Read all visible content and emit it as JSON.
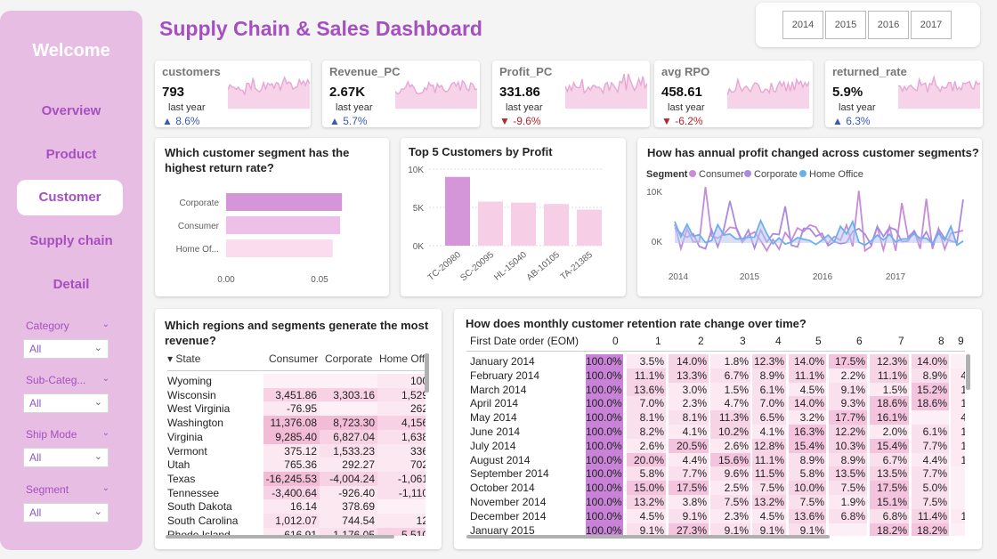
{
  "sidebar": {
    "welcome": "Welcome",
    "nav": [
      "Overview",
      "Product",
      "Customer",
      "Supply chain",
      "Detail"
    ],
    "active": "Customer",
    "filters": [
      {
        "label": "Category",
        "value": "All"
      },
      {
        "label": "Sub-Categ...",
        "value": "All"
      },
      {
        "label": "Ship Mode",
        "value": "All"
      },
      {
        "label": "Segment",
        "value": "All"
      }
    ]
  },
  "title": "Supply Chain & Sales Dashboard",
  "years": [
    "2014",
    "2015",
    "2016",
    "2017"
  ],
  "kpis": [
    {
      "label": "customers",
      "value": "793",
      "ly": "last year",
      "delta": "▲ 8.6%",
      "dir": "up"
    },
    {
      "label": "Revenue_PC",
      "value": "2.67K",
      "ly": "last year",
      "delta": "▲ 5.7%",
      "dir": "up"
    },
    {
      "label": "Profit_PC",
      "value": "331.86",
      "ly": "last year",
      "delta": "▼ -9.6%",
      "dir": "down"
    },
    {
      "label": "avg RPO",
      "value": "458.61",
      "ly": "last year",
      "delta": "▼ -6.2%",
      "dir": "down"
    },
    {
      "label": "returned_rate",
      "value": "5.9%",
      "ly": "last year",
      "delta": "▲ 6.3%",
      "dir": "up"
    }
  ],
  "colors": {
    "accent": "#a54fc1",
    "pink": "#e8bde3",
    "bar_dark": "#d596d9",
    "bar_light": "#f6cfe6",
    "consumer": "#c78bd8",
    "corporate": "#a98ae0",
    "home_office": "#6ab0ef"
  },
  "chart_data": [
    {
      "type": "bar",
      "orientation": "horizontal",
      "title": "Which customer segment has the highest return rate?",
      "categories": [
        "Corporate",
        "Consumer",
        "Home Of..."
      ],
      "values": [
        0.062,
        0.061,
        0.057
      ],
      "xticks": [
        "0.00",
        "0.05"
      ],
      "xlim": [
        0,
        0.07
      ]
    },
    {
      "type": "bar",
      "title": "Top 5 Customers by Profit",
      "categories": [
        "TC-20980",
        "SC-20095",
        "HL-15040",
        "AB-10105",
        "TA-21385"
      ],
      "values": [
        8981,
        5757,
        5622,
        5444,
        4703
      ],
      "yticks": [
        "10K",
        "5K",
        "0K"
      ],
      "ylim": [
        0,
        10000
      ]
    },
    {
      "type": "line",
      "title": "How has annual profit changed across customer segments?",
      "legend_title": "Segment",
      "series_names": [
        "Consumer",
        "Corporate",
        "Home Office"
      ],
      "yticks": [
        "10K",
        "0K"
      ],
      "xticks": [
        "2014",
        "2015",
        "2016",
        "2017"
      ]
    }
  ],
  "regions": {
    "title": "Which regions and segments generate the most revenue?",
    "headers": [
      "State",
      "Consumer",
      "Corporate",
      "Home Off"
    ],
    "rows": [
      [
        "Wyoming",
        "",
        "",
        "100"
      ],
      [
        "Wisconsin",
        "3,451.86",
        "3,303.16",
        "1,529"
      ],
      [
        "West Virginia",
        "-76.95",
        "",
        "262"
      ],
      [
        "Washington",
        "11,376.08",
        "8,723.30",
        "4,156"
      ],
      [
        "Virginia",
        "9,285.40",
        "6,827.04",
        "1,638"
      ],
      [
        "Vermont",
        "375.12",
        "1,533.23",
        "336"
      ],
      [
        "Utah",
        "765.36",
        "292.27",
        "702"
      ],
      [
        "Texas",
        "-16,245.53",
        "-4,004.24",
        "-1,061"
      ],
      [
        "Tennessee",
        "-3,400.64",
        "-926.40",
        "-1,110"
      ],
      [
        "South Dakota",
        "16.14",
        "378.69",
        ""
      ],
      [
        "South Carolina",
        "1,012.07",
        "744.54",
        "12"
      ],
      [
        "Rhode Island",
        "616.91",
        "1,176.05",
        "5,510"
      ]
    ]
  },
  "retention": {
    "title": "How does monthly customer retention rate change over time?",
    "row_header": "First Date order (EOM)",
    "cols": [
      "0",
      "1",
      "2",
      "3",
      "4",
      "5",
      "6",
      "7",
      "8",
      "9"
    ],
    "rows": [
      [
        "January 2014",
        "100.0%",
        "3.5%",
        "14.0%",
        "1.8%",
        "12.3%",
        "14.0%",
        "17.5%",
        "12.3%",
        "14.0%",
        ""
      ],
      [
        "February 2014",
        "100.0%",
        "11.1%",
        "13.3%",
        "6.7%",
        "8.9%",
        "11.1%",
        "2.2%",
        "11.1%",
        "8.9%",
        "4"
      ],
      [
        "March 2014",
        "100.0%",
        "13.6%",
        "3.0%",
        "1.5%",
        "6.1%",
        "4.5%",
        "9.1%",
        "1.5%",
        "15.2%",
        "1"
      ],
      [
        "April 2014",
        "100.0%",
        "7.0%",
        "2.3%",
        "4.7%",
        "7.0%",
        "14.0%",
        "9.3%",
        "18.6%",
        "18.6%",
        "1"
      ],
      [
        "May 2014",
        "100.0%",
        "8.1%",
        "8.1%",
        "11.3%",
        "6.5%",
        "3.2%",
        "17.7%",
        "16.1%",
        "",
        "4"
      ],
      [
        "June 2014",
        "100.0%",
        "8.2%",
        "4.1%",
        "10.2%",
        "4.1%",
        "16.3%",
        "12.2%",
        "2.0%",
        "6.1%",
        "1"
      ],
      [
        "July 2014",
        "100.0%",
        "2.6%",
        "20.5%",
        "2.6%",
        "12.8%",
        "15.4%",
        "10.3%",
        "15.4%",
        "7.7%",
        "1"
      ],
      [
        "August 2014",
        "100.0%",
        "20.0%",
        "4.4%",
        "15.6%",
        "11.1%",
        "8.9%",
        "8.9%",
        "6.7%",
        "4.4%",
        "1"
      ],
      [
        "September 2014",
        "100.0%",
        "5.8%",
        "7.7%",
        "9.6%",
        "11.5%",
        "5.8%",
        "13.5%",
        "13.5%",
        "7.7%",
        ""
      ],
      [
        "October 2014",
        "100.0%",
        "15.0%",
        "17.5%",
        "2.5%",
        "7.5%",
        "10.0%",
        "7.5%",
        "17.5%",
        "5.0%",
        ""
      ],
      [
        "November 2014",
        "100.0%",
        "13.2%",
        "3.8%",
        "7.5%",
        "13.2%",
        "7.5%",
        "1.9%",
        "15.1%",
        "7.5%",
        ""
      ],
      [
        "December 2014",
        "100.0%",
        "4.5%",
        "9.1%",
        "2.3%",
        "4.5%",
        "13.6%",
        "6.8%",
        "6.8%",
        "11.4%",
        "1"
      ],
      [
        "January 2015",
        "100.0%",
        "9.1%",
        "27.3%",
        "9.1%",
        "9.1%",
        "9.1%",
        "",
        "18.2%",
        "18.2%",
        ""
      ]
    ]
  }
}
